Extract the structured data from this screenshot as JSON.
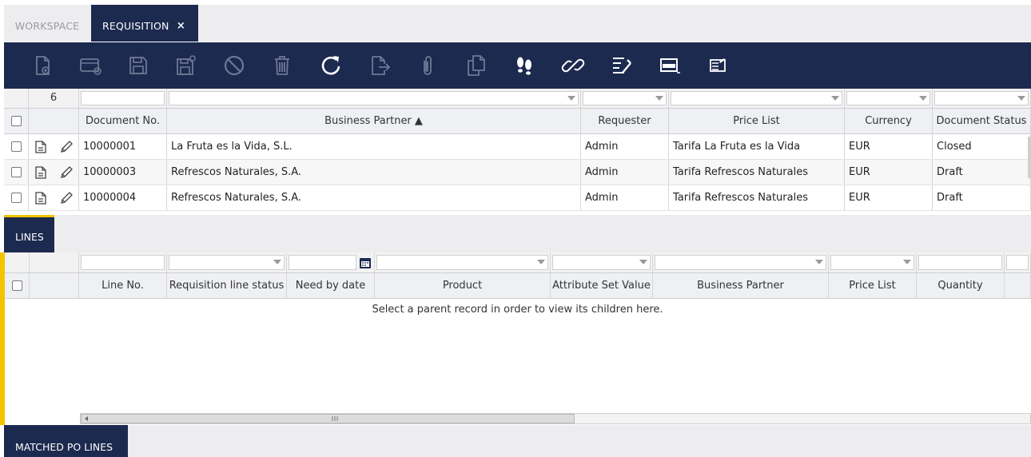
{
  "tabs": {
    "workspace": "WORKSPACE",
    "requisition": "REQUISITION",
    "close": "×"
  },
  "toolbar": {
    "buttons": [
      {
        "name": "new-document-icon",
        "enabled": false
      },
      {
        "name": "new-row-icon",
        "enabled": false
      },
      {
        "name": "save-icon",
        "enabled": false
      },
      {
        "name": "save-close-icon",
        "enabled": false
      },
      {
        "name": "undo-icon",
        "enabled": false
      },
      {
        "name": "delete-icon",
        "enabled": false
      },
      {
        "name": "refresh-icon",
        "enabled": true
      },
      {
        "name": "export-icon",
        "enabled": false
      },
      {
        "name": "attachment-icon",
        "enabled": false
      },
      {
        "name": "clone-icon",
        "enabled": false
      },
      {
        "name": "audit-trail-icon",
        "enabled": true
      },
      {
        "name": "link-icon",
        "enabled": true
      },
      {
        "name": "tree-view-icon",
        "enabled": true
      },
      {
        "name": "form-view-icon",
        "enabled": true
      },
      {
        "name": "notes-icon",
        "enabled": true
      }
    ]
  },
  "header_grid": {
    "record_count": "6",
    "columns": [
      "Document No.",
      "Business Partner ▲",
      "Requester",
      "Price List",
      "Currency",
      "Document Status"
    ],
    "rows": [
      {
        "doc_no": "10000001",
        "partner": "La Fruta es la Vida, S.L.",
        "requester": "Admin",
        "price_list": "Tarifa La Fruta es la Vida",
        "currency": "EUR",
        "status": "Closed"
      },
      {
        "doc_no": "10000003",
        "partner": "Refrescos Naturales, S.A.",
        "requester": "Admin",
        "price_list": "Tarifa Refrescos Naturales",
        "currency": "EUR",
        "status": "Draft"
      },
      {
        "doc_no": "10000004",
        "partner": "Refrescos Naturales, S.A.",
        "requester": "Admin",
        "price_list": "Tarifa Refrescos Naturales",
        "currency": "EUR",
        "status": "Draft"
      }
    ]
  },
  "lines": {
    "tab_label": "LINES",
    "columns": [
      "Line No.",
      "Requisition line status",
      "Need by date",
      "Product",
      "Attribute Set Value",
      "Business Partner",
      "Price List",
      "Quantity"
    ],
    "empty_message": "Select a parent record in order to view its children here."
  },
  "matched": {
    "tab_label": "MATCHED PO LINES"
  },
  "colors": {
    "navy": "#1c2a4f",
    "accent_yellow": "#f5c400"
  }
}
